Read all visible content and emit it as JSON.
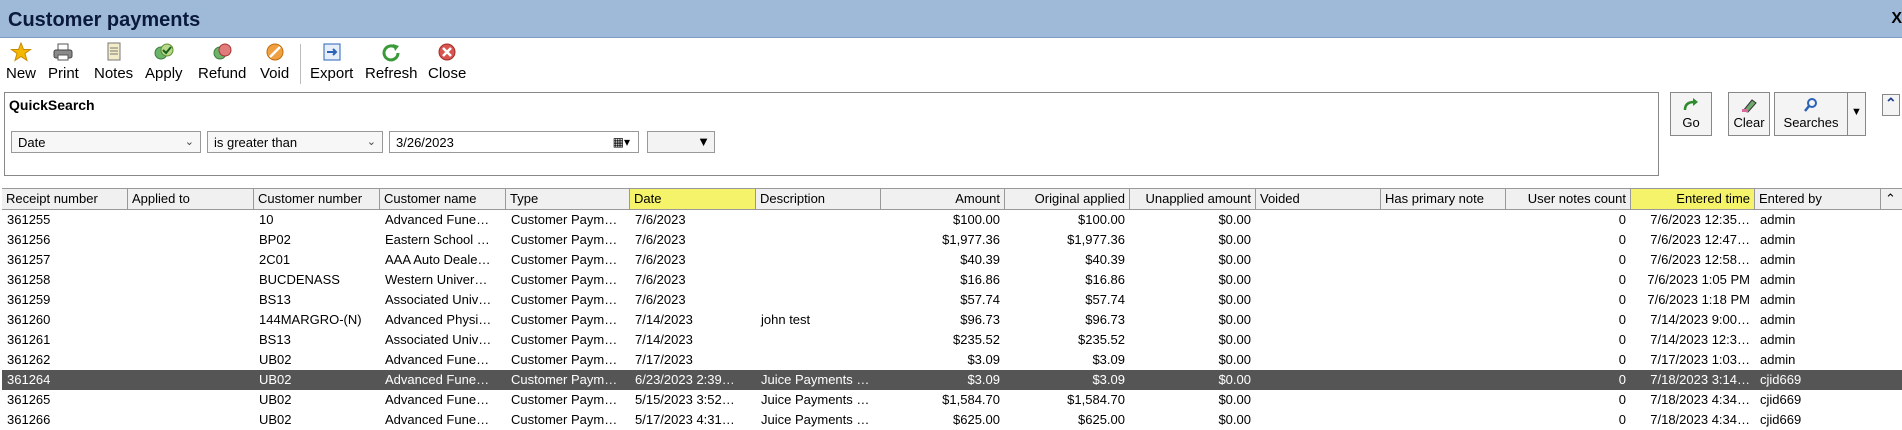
{
  "window": {
    "title": "Customer payments",
    "close_label": "X"
  },
  "toolbar": {
    "buttons": [
      {
        "label": "New",
        "icon": "star-icon"
      },
      {
        "label": "Print",
        "icon": "printer-icon"
      },
      {
        "label": "Notes",
        "icon": "notes-icon"
      },
      {
        "label": "Apply",
        "icon": "apply-icon"
      },
      {
        "label": "Refund",
        "icon": "refund-icon"
      },
      {
        "label": "Void",
        "icon": "void-icon"
      },
      {
        "label": "Export",
        "icon": "export-icon"
      },
      {
        "label": "Refresh",
        "icon": "refresh-icon"
      },
      {
        "label": "Close",
        "icon": "close-icon"
      }
    ]
  },
  "quicksearch": {
    "title": "QuickSearch",
    "field": "Date",
    "operator": "is greater than",
    "value": "3/26/2023",
    "go_label": "Go",
    "clear_label": "Clear",
    "searches_label": "Searches"
  },
  "grid": {
    "columns": [
      "Receipt number",
      "Applied to",
      "Customer number",
      "Customer name",
      "Type",
      "Date",
      "Description",
      "Amount",
      "Original applied",
      "Unapplied amount",
      "Voided",
      "Has primary note",
      "User notes count",
      "Entered time",
      "Entered by"
    ],
    "rows": [
      [
        "361255",
        "",
        "10",
        "Advanced Fune…",
        "Customer Paym…",
        "7/6/2023",
        "",
        "$100.00",
        "$100.00",
        "$0.00",
        "",
        "",
        "0",
        "7/6/2023 12:35…",
        "admin"
      ],
      [
        "361256",
        "",
        "BP02",
        "Eastern School …",
        "Customer Paym…",
        "7/6/2023",
        "",
        "$1,977.36",
        "$1,977.36",
        "$0.00",
        "",
        "",
        "0",
        "7/6/2023 12:47…",
        "admin"
      ],
      [
        "361257",
        "",
        "2C01",
        "AAA Auto Deale…",
        "Customer Paym…",
        "7/6/2023",
        "",
        "$40.39",
        "$40.39",
        "$0.00",
        "",
        "",
        "0",
        "7/6/2023 12:58…",
        "admin"
      ],
      [
        "361258",
        "",
        "BUCDENASS",
        "Western Univer…",
        "Customer Paym…",
        "7/6/2023",
        "",
        "$16.86",
        "$16.86",
        "$0.00",
        "",
        "",
        "0",
        "7/6/2023 1:05 PM",
        "admin"
      ],
      [
        "361259",
        "",
        "BS13",
        "Associated Univ…",
        "Customer Paym…",
        "7/6/2023",
        "",
        "$57.74",
        "$57.74",
        "$0.00",
        "",
        "",
        "0",
        "7/6/2023 1:18 PM",
        "admin"
      ],
      [
        "361260",
        "",
        "144MARGRO-(N)",
        "Advanced Physi…",
        "Customer Paym…",
        "7/14/2023",
        "john test",
        "$96.73",
        "$96.73",
        "$0.00",
        "",
        "",
        "0",
        "7/14/2023 9:00…",
        "admin"
      ],
      [
        "361261",
        "",
        "BS13",
        "Associated Univ…",
        "Customer Paym…",
        "7/14/2023",
        "",
        "$235.52",
        "$235.52",
        "$0.00",
        "",
        "",
        "0",
        "7/14/2023 12:3…",
        "admin"
      ],
      [
        "361262",
        "",
        "UB02",
        "Advanced Fune…",
        "Customer Paym…",
        "7/17/2023",
        "",
        "$3.09",
        "$3.09",
        "$0.00",
        "",
        "",
        "0",
        "7/17/2023 1:03…",
        "admin"
      ],
      [
        "361264",
        "",
        "UB02",
        "Advanced Fune…",
        "Customer Paym…",
        "6/23/2023 2:39…",
        "Juice Payments …",
        "$3.09",
        "$3.09",
        "$0.00",
        "",
        "",
        "0",
        "7/18/2023 3:14…",
        "cjid669"
      ],
      [
        "361265",
        "",
        "UB02",
        "Advanced Fune…",
        "Customer Paym…",
        "5/15/2023 3:52…",
        "Juice Payments …",
        "$1,584.70",
        "$1,584.70",
        "$0.00",
        "",
        "",
        "0",
        "7/18/2023 4:34…",
        "cjid669"
      ],
      [
        "361266",
        "",
        "UB02",
        "Advanced Fune…",
        "Customer Paym…",
        "5/17/2023 4:31…",
        "Juice Payments …",
        "$625.00",
        "$625.00",
        "$0.00",
        "",
        "",
        "0",
        "7/18/2023 4:34…",
        "cjid669"
      ]
    ],
    "selected_row": 8,
    "highlight_color": "#f4f36a",
    "selected_color": "#555555"
  }
}
